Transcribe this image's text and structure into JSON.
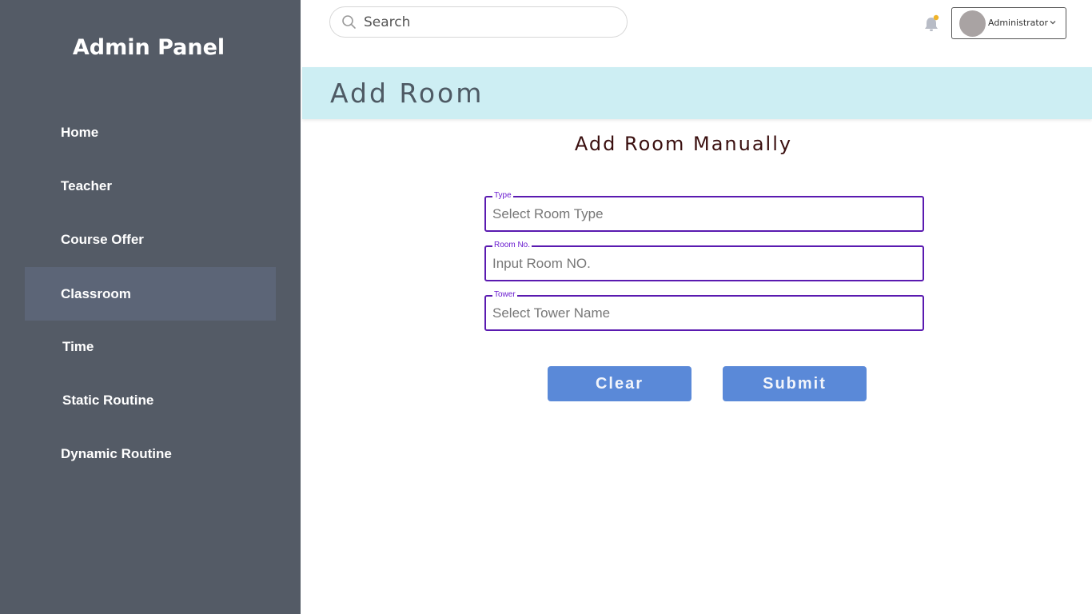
{
  "sidebar": {
    "brand": "Admin Panel",
    "items": [
      {
        "label": "Home"
      },
      {
        "label": "Teacher"
      },
      {
        "label": "Course Offer"
      },
      {
        "label": "Classroom",
        "active": true
      },
      {
        "label": "Time"
      },
      {
        "label": "Static Routine"
      },
      {
        "label": "Dynamic Routine"
      }
    ]
  },
  "header": {
    "search_placeholder": "Search",
    "notification_icon": "bell-icon",
    "notification_dot_color": "#f0b429",
    "user_label": "Administrator"
  },
  "banner": {
    "title": "Add Room"
  },
  "form": {
    "heading": "Add Room Manually",
    "fields": [
      {
        "label": "Type",
        "placeholder": "Select Room Type",
        "value": ""
      },
      {
        "label": "Room No.",
        "placeholder": "Input Room NO.",
        "value": ""
      },
      {
        "label": "Tower",
        "placeholder": "Select Tower Name",
        "value": ""
      }
    ],
    "clear_label": "Clear",
    "submit_label": "Submit"
  },
  "colors": {
    "sidebar_bg": "#545b66",
    "active_item_bg": "#5c6577",
    "banner_bg": "#cdeef3",
    "field_border": "#5a1ab0",
    "button_bg": "#5a89d8"
  }
}
